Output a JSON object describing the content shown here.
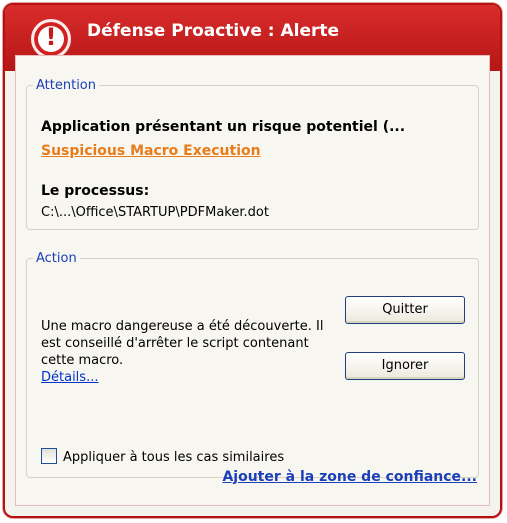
{
  "window": {
    "title": "Défense Proactive : Alerte"
  },
  "attention": {
    "legend": "Attention",
    "headline": "Application présentant un risque potentiel (...",
    "threat_link": "Suspicious Macro Execution",
    "process_label": "Le processus:",
    "process_path": "C:\\...\\Office\\STARTUP\\PDFMaker.dot"
  },
  "action": {
    "legend": "Action",
    "description": "Une macro dangereuse a été découverte. Il est conseillé d'arrêter le script contenant cette macro.",
    "details_link": "Détails...",
    "quit_button": "Quitter",
    "ignore_button": "Ignorer",
    "apply_all_label": "Appliquer à tous les cas similaires",
    "apply_all_checked": false
  },
  "footer": {
    "trust_zone_link": "Ajouter à la zone de confiance..."
  },
  "colors": {
    "title_bar": "#c41a1a",
    "legend_text": "#1a3fb8",
    "threat_link": "#e97c1a",
    "details_link": "#0033cc"
  },
  "icons": {
    "title": "exclamation-circle-icon"
  }
}
